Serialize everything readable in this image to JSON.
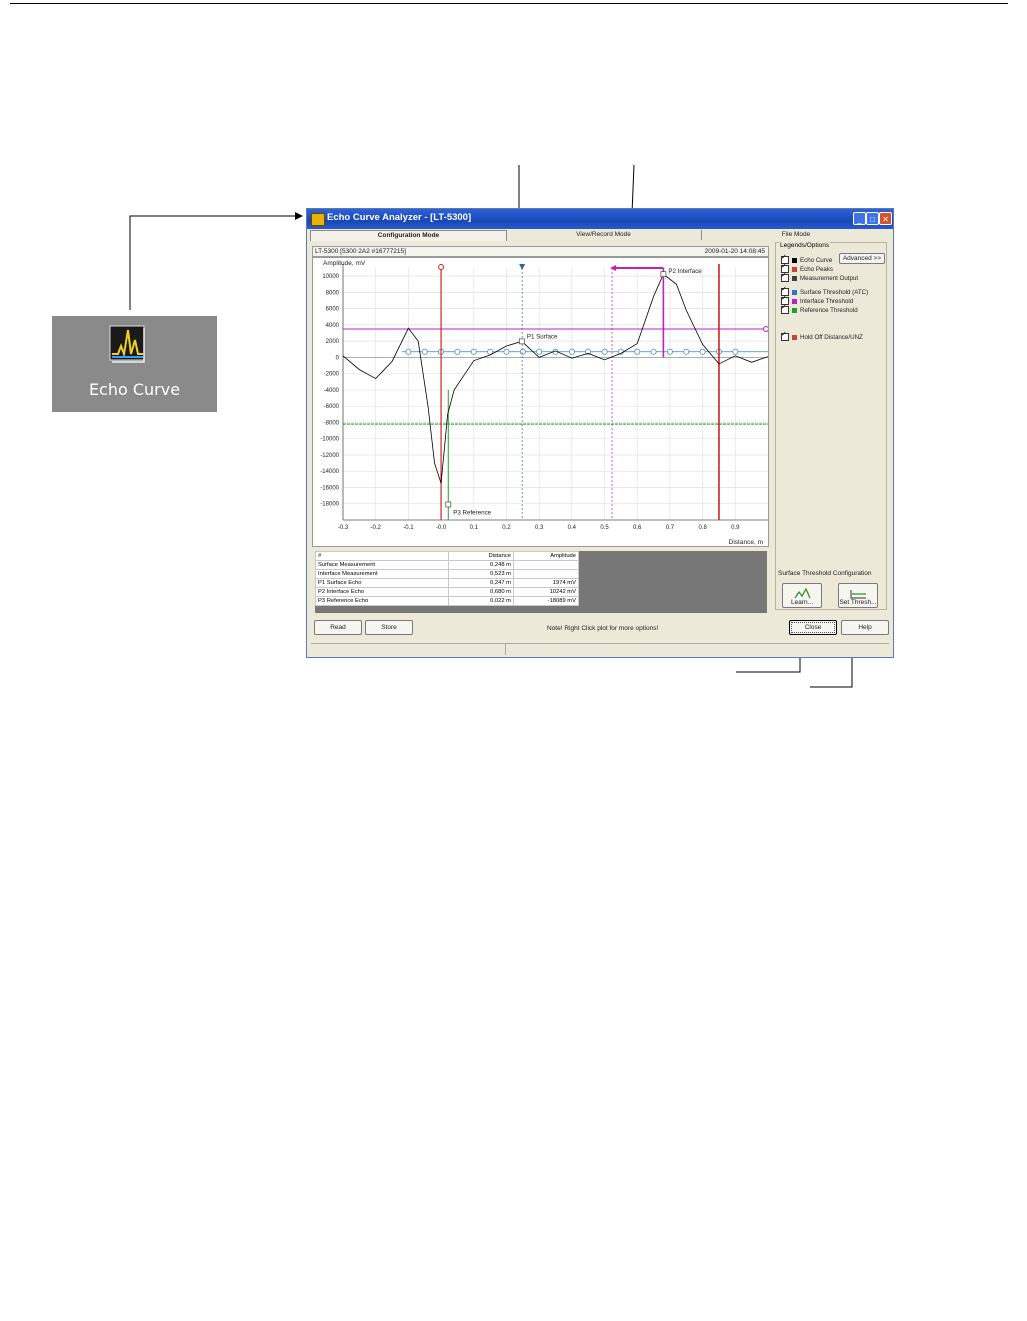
{
  "desktop_icon": {
    "label": "Echo Curve",
    "icon": "echo-curve-app-icon"
  },
  "window": {
    "title": "Echo Curve Analyzer - [LT-5300]",
    "controls": [
      "_",
      "□",
      "✕"
    ],
    "tabs": [
      "Configuration Mode",
      "View/Record Mode",
      "File Mode"
    ],
    "active_tab": "Configuration Mode",
    "device_info": "LT-5300 [5300 2A2 #16777215]",
    "timestamp": "2009-01-20 14:08:45"
  },
  "chart_data": {
    "type": "line",
    "ylabel": "Amplitude, mV",
    "xlabel": "Distance, m",
    "x_ticks": [
      "-0.3",
      "-0.2",
      "-0.1",
      "-0.0",
      "0.1",
      "0.2",
      "0.3",
      "0.4",
      "0.5",
      "0.6",
      "0.7",
      "0.8",
      "0.9"
    ],
    "y_ticks": [
      "10000",
      "8000",
      "6000",
      "4000",
      "2000",
      "0",
      "-2000",
      "-4000",
      "-6000",
      "-8000",
      "-10000",
      "-12000",
      "-14000",
      "-16000",
      "-18000"
    ],
    "xlim": [
      -0.3,
      1.0
    ],
    "ylim": [
      -20000,
      11000
    ],
    "grid": true,
    "echo_curve": {
      "x": [
        -0.3,
        -0.25,
        -0.2,
        -0.15,
        -0.1,
        -0.07,
        -0.04,
        -0.02,
        0.0,
        0.02,
        0.04,
        0.07,
        0.1,
        0.15,
        0.2,
        0.247,
        0.3,
        0.35,
        0.4,
        0.45,
        0.5,
        0.55,
        0.6,
        0.65,
        0.68,
        0.72,
        0.75,
        0.8,
        0.85,
        0.9,
        0.95,
        1.0
      ],
      "y": [
        200,
        -1500,
        -2600,
        -500,
        3600,
        2000,
        -6000,
        -13000,
        -15500,
        -7000,
        -4000,
        -2200,
        -400,
        300,
        1400,
        1974,
        0,
        800,
        -100,
        500,
        -300,
        500,
        1700,
        7500,
        10242,
        9000,
        5800,
        1600,
        -800,
        200,
        -600,
        100
      ]
    },
    "peaks": [
      {
        "label": "P1 Surface",
        "x": 0.247,
        "y": 1974
      },
      {
        "label": "P2 Interface",
        "x": 0.68,
        "y": 10242
      },
      {
        "label": "P3 Reference",
        "x": 0.022,
        "y": -18089
      }
    ],
    "interface_threshold_mV": 3500,
    "reference_threshold_mV": -8200,
    "surface_threshold_mV": 700,
    "markers": {
      "hold_off_x": 0.0,
      "reference_marker_x": 0.022,
      "surface_measurement_x": 0.248,
      "interface_measurement_x": 0.523,
      "unz_x": 0.85
    },
    "colors": {
      "echo_curve": "#000000",
      "surface_threshold": "#2a8cb4",
      "interface_threshold": "#c020c0",
      "reference_threshold": "#20a020",
      "hold_off": "#d02020"
    }
  },
  "results_table": {
    "headers": [
      "#",
      "Distance",
      "Amplitude"
    ],
    "rows": [
      [
        "Surface Measurement",
        "0,248 m",
        ""
      ],
      [
        "Interface Measurement",
        "0,523 m",
        ""
      ],
      [
        "P1 Surface Echo",
        "0,247 m",
        "1974 mV"
      ],
      [
        "P2 Interface Echo",
        "0,680 m",
        "10242 mV"
      ],
      [
        "P3 Reference Echo",
        "0,022 m",
        "-18089 mV"
      ]
    ]
  },
  "legend": {
    "title": "Legends/Options",
    "advanced_label": "Advanced >>",
    "items": [
      {
        "label": "Echo Curve",
        "color": "#000000"
      },
      {
        "label": "Echo Peaks",
        "color": "#d04040"
      },
      {
        "label": "Measurement Output",
        "color": "#404040"
      },
      {
        "label": "Surface Threshold (ATC)",
        "color": "#2a78c8"
      },
      {
        "label": "Interface Threshold",
        "color": "#c020c0"
      },
      {
        "label": "Reference Threshold",
        "color": "#20a020"
      },
      {
        "label": "Hold Off Distance/UNZ",
        "color": "#d04040"
      }
    ]
  },
  "surface_threshold_config": {
    "title": "Surface Threshold Configuration",
    "learn_label": "Learn...",
    "set_label": "Set Thresh..."
  },
  "footer": {
    "read_label": "Read",
    "store_label": "Store",
    "note": "Note! Right Click plot for more options!",
    "close_label": "Close",
    "help_label": "Help"
  }
}
